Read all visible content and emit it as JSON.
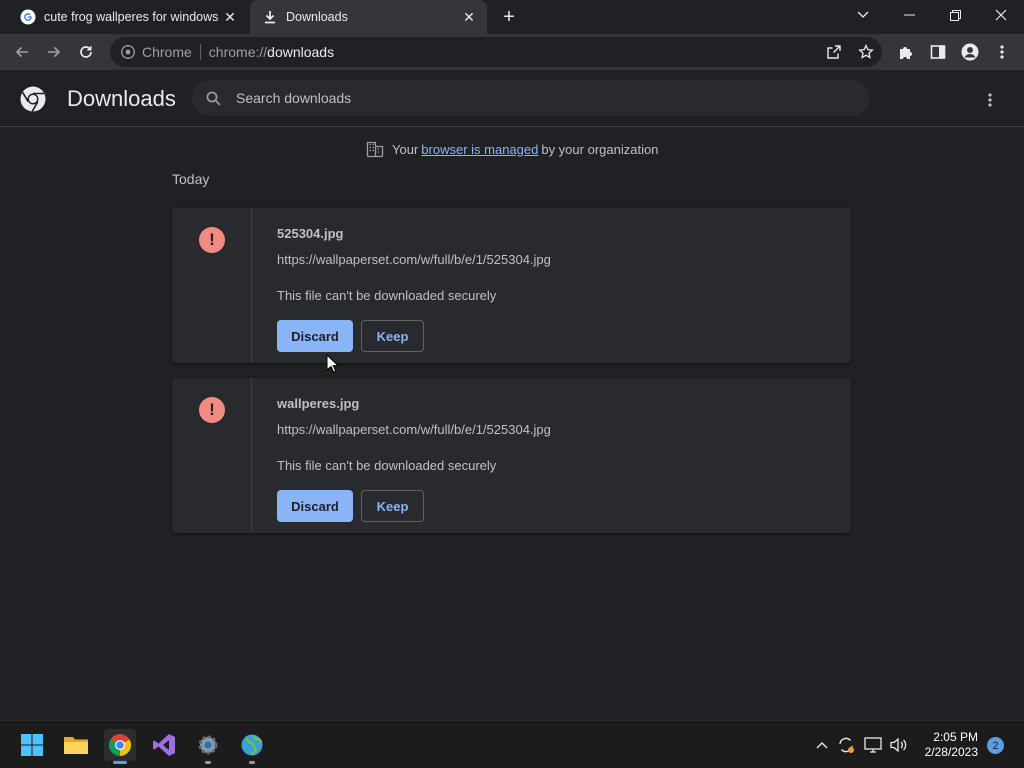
{
  "tabs": [
    {
      "title": "cute frog wallperes for windows",
      "favicon": "google-g-icon"
    },
    {
      "title": "Downloads",
      "favicon": "download-icon"
    }
  ],
  "omnibox": {
    "scheme_label": "Chrome",
    "url_prefix": "chrome://",
    "url_host": "downloads"
  },
  "page": {
    "title": "Downloads",
    "search_placeholder": "Search downloads",
    "managed_prefix": "Your",
    "managed_link": "browser is managed",
    "managed_suffix": "by your organization",
    "section": "Today"
  },
  "downloads": [
    {
      "name": "525304.jpg",
      "url": "https://wallpaperset.com/w/full/b/e/1/525304.jpg",
      "status": "This file can't be downloaded securely",
      "discard": "Discard",
      "keep": "Keep"
    },
    {
      "name": "wallperes.jpg",
      "url": "https://wallpaperset.com/w/full/b/e/1/525304.jpg",
      "status": "This file can't be downloaded securely",
      "discard": "Discard",
      "keep": "Keep"
    }
  ],
  "taskbar": {
    "time": "2:05 PM",
    "date": "2/28/2023",
    "notifications": "2"
  },
  "colors": {
    "accent": "#8ab4f8",
    "warning": "#f28b82",
    "background": "#202124",
    "card": "#292a2d"
  }
}
